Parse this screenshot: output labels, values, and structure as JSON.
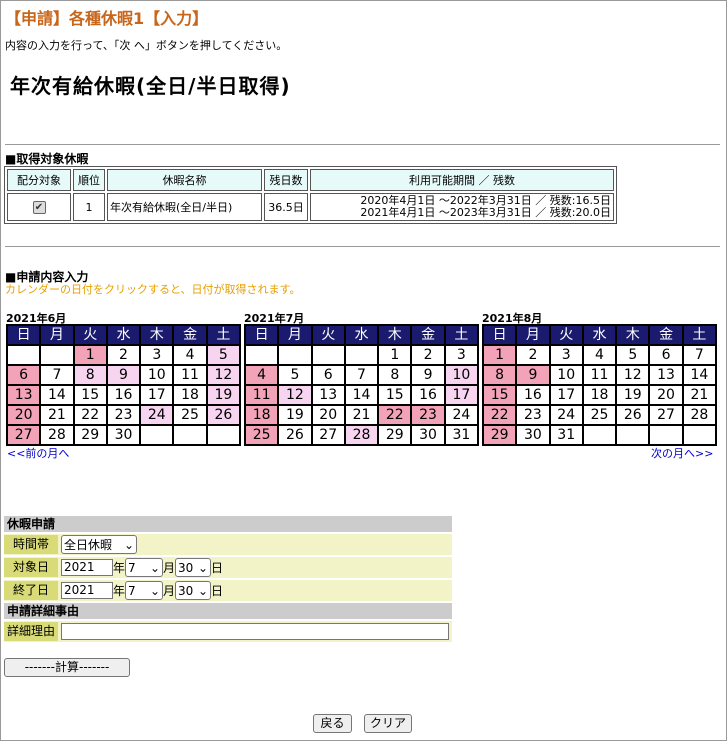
{
  "header": {
    "title": "【申請】各種休暇1【入力】",
    "instruction": "内容の入力を行って、「次 へ」ボタンを押してください。",
    "leave_type": "年次有給休暇(全日/半日取得)"
  },
  "target_section": {
    "heading": "■取得対象休暇",
    "columns": [
      "配分対象",
      "順位",
      "休暇名称",
      "残日数",
      "利用可能期間 ／ 残数"
    ],
    "row": {
      "checked": true,
      "rank": "1",
      "name": "年次有給休暇(全日/半日)",
      "remaining": "36.5日",
      "period1": "2020年4月1日 ～2022年3月31日 ／ 残数:16.5日",
      "period2": "2021年4月1日 ～2023年3月31日 ／ 残数:20.0日"
    }
  },
  "apply_section": {
    "heading": "■申請内容入力",
    "hint": "カレンダーの日付をクリックすると、日付が取得されます。"
  },
  "calendar": {
    "weekdays": [
      "日",
      "月",
      "火",
      "水",
      "木",
      "金",
      "土"
    ],
    "prev_label": "<<前の月へ",
    "next_label": "次の月へ>>",
    "months": [
      {
        "title": "2021年6月",
        "days": [
          "",
          "",
          "1",
          "2",
          "3",
          "4",
          "5",
          "6",
          "7",
          "8",
          "9",
          "10",
          "11",
          "12",
          "13",
          "14",
          "15",
          "16",
          "17",
          "18",
          "19",
          "20",
          "21",
          "22",
          "23",
          "24",
          "25",
          "26",
          "27",
          "28",
          "29",
          "30",
          "",
          "",
          ""
        ],
        "holidays": [
          "6",
          "13",
          "20",
          "27",
          "1"
        ],
        "highlighted": [
          "5",
          "8",
          "9",
          "12",
          "19",
          "24",
          "26"
        ]
      },
      {
        "title": "2021年7月",
        "days": [
          "",
          "",
          "",
          "",
          "1",
          "2",
          "3",
          "4",
          "5",
          "6",
          "7",
          "8",
          "9",
          "10",
          "11",
          "12",
          "13",
          "14",
          "15",
          "16",
          "17",
          "18",
          "19",
          "20",
          "21",
          "22",
          "23",
          "24",
          "25",
          "26",
          "27",
          "28",
          "29",
          "30",
          "31"
        ],
        "holidays": [
          "4",
          "11",
          "18",
          "25",
          "22",
          "23"
        ],
        "highlighted": [
          "10",
          "12",
          "17",
          "28"
        ]
      },
      {
        "title": "2021年8月",
        "days": [
          "1",
          "2",
          "3",
          "4",
          "5",
          "6",
          "7",
          "8",
          "9",
          "10",
          "11",
          "12",
          "13",
          "14",
          "15",
          "16",
          "17",
          "18",
          "19",
          "20",
          "21",
          "22",
          "23",
          "24",
          "25",
          "26",
          "27",
          "28",
          "29",
          "30",
          "31",
          "",
          "",
          "",
          ""
        ],
        "holidays": [
          "1",
          "8",
          "9",
          "15",
          "22",
          "29"
        ],
        "highlighted": []
      }
    ]
  },
  "form": {
    "heading": "休暇申請",
    "time_label": "時間帯",
    "time_value": "全日休暇",
    "start_label": "対象日",
    "end_label": "終了日",
    "year_value": "2021",
    "year_unit": "年",
    "month_value": "7",
    "month_unit": "月",
    "day_value": "30",
    "day_unit": "日",
    "detail_heading": "申請詳細事由",
    "reason_label": "詳細理由",
    "reason_value": ""
  },
  "buttons": {
    "calc": "-------計算-------",
    "back": "戻る",
    "clear": "クリア"
  },
  "colors": {
    "title": "#c8661c",
    "hint": "#e8a000",
    "calendar_header": "#1a1a6e",
    "holiday": "#f2a3b8",
    "highlight": "#f7d4f0"
  }
}
